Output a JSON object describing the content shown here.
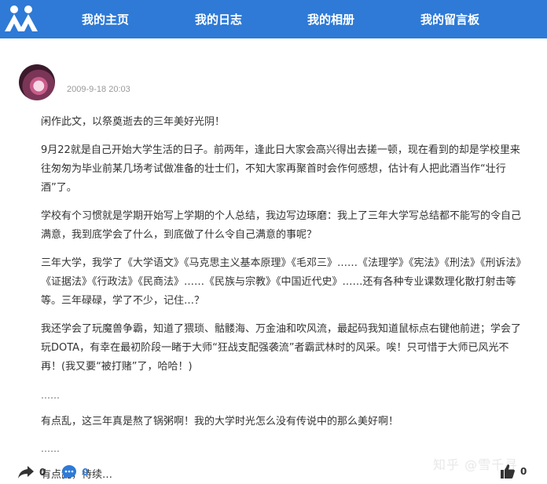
{
  "nav": {
    "home": "我的主页",
    "diary": "我的日志",
    "album": "我的相册",
    "guestbook": "我的留言板"
  },
  "post": {
    "timestamp": "2009-9-18 20:03",
    "paragraphs": [
      "闲作此文，以祭奠逝去的三年美好光阴！",
      "9月22就是自己开始大学生活的日子。前两年，逢此日大家会高兴得出去搓一顿，现在看到的却是学校里来往匆匆为毕业前某几场考试做准备的壮士们，不知大家再聚首时会作何感想，估计有人把此酒当作“壮行酒”了。",
      "学校有个习惯就是学期开始写上学期的个人总结，我边写边琢磨：我上了三年大学写总结都不能写的令自己满意，我到底学会了什么，到底做了什么令自己满意的事呢？",
      "三年大学，我学了《大学语文》《马克思主义基本原理》《毛邓三》……《法理学》《宪法》《刑法》《刑诉法》《证据法》《行政法》《民商法》……《民族与宗教》《中国近代史》……还有各种专业课数理化散打射击等等。三年碌碌，学了不少，记住…？",
      "我还学会了玩魔兽争霸，知道了猥琐、骷髅海、万金油和吹风流，最起码我知道鼠标点右键他前进；学会了玩DOTA，有幸在最初阶段一睹于大师“狂战支配强袭流”者霸武林时的风采。唉！只可惜于大师已风光不再！(我又要“被打赌”了，哈哈！)",
      "……",
      "有点乱，这三年真是熬了锅粥啊！我的大学时光怎么没有传说中的那么美好啊！",
      "……",
      "有点乱，待续…"
    ]
  },
  "footer": {
    "share_count": "0",
    "comment_count": "0",
    "like_count": "0",
    "watermark": "知乎 @雪千寻"
  },
  "colors": {
    "topbar": "#2e7ad6",
    "comment_accent": "#2e7ad6"
  },
  "icons": {
    "logo": "renren-logo-icon",
    "share": "share-arrow-icon",
    "comment": "comment-bubble-icon",
    "like": "thumbs-up-icon"
  }
}
